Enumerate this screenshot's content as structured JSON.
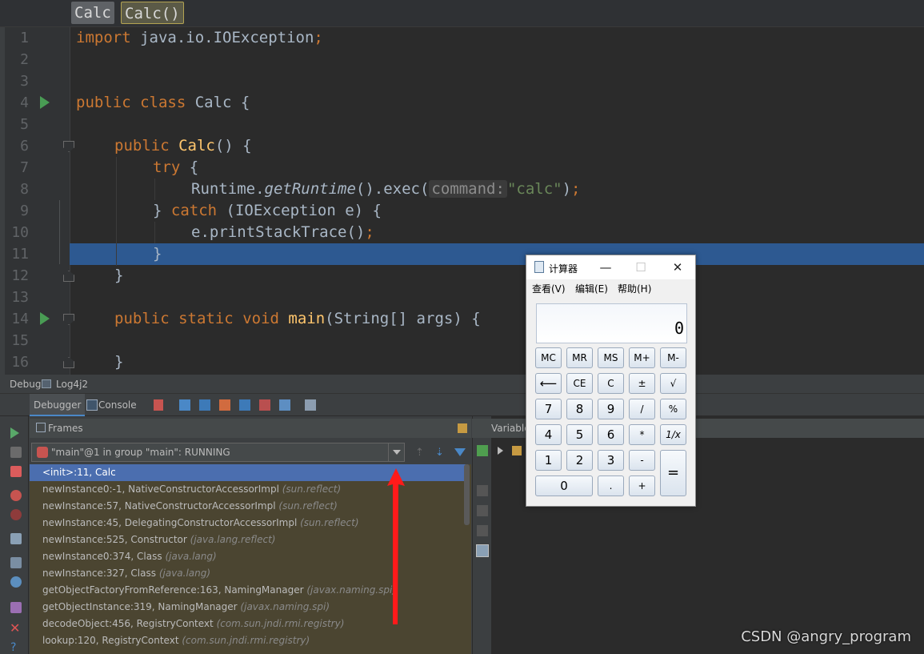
{
  "editor": {
    "breadcrumbs": [
      "Calc",
      "Calc()"
    ],
    "line_numbers": [
      "1",
      "2",
      "3",
      "4",
      "5",
      "6",
      "7",
      "8",
      "9",
      "10",
      "11",
      "12",
      "13",
      "14",
      "15",
      "16"
    ],
    "code": {
      "l1_import": "import",
      "l1_rest": " java.io.IOException",
      "l1_semi": ";",
      "l4_public": "public",
      "l4_class": "class",
      "l4_rest": " Calc {",
      "l6_public": "public",
      "l6_name": "Calc",
      "l6_rest": "() {",
      "l7_try": "try",
      "l7_rest": " {",
      "l8_a": "Runtime.",
      "l8_b": "getRuntime",
      "l8_c": "().exec(",
      "l8_hint": "command:",
      "l8_str": "\"calc\"",
      "l8_d": ")",
      "l8_semi": ";",
      "l9_a": "} ",
      "l9_catch": "catch",
      "l9_b": " (IOException e) {",
      "l10_a": "e.printStackTrace()",
      "l10_semi": ";",
      "l11": "}",
      "l12": "}",
      "l14_public": "public",
      "l14_static": "static",
      "l14_void": "void",
      "l14_main": "main",
      "l14_rest": "(String[] args) {",
      "l16": "}"
    }
  },
  "debug": {
    "tabs": [
      "Debug",
      "Log4j2"
    ],
    "toolbar": {
      "debugger": "Debugger",
      "console": "Console"
    },
    "frames_title": "Frames",
    "variables_title": "Variables",
    "thread": "\"main\"@1 in group \"main\": RUNNING",
    "frames": [
      {
        "method": "<init>:11, Calc",
        "pkg": ""
      },
      {
        "method": "newInstance0:-1, NativeConstructorAccessorImpl",
        "pkg": "(sun.reflect)"
      },
      {
        "method": "newInstance:57, NativeConstructorAccessorImpl",
        "pkg": "(sun.reflect)"
      },
      {
        "method": "newInstance:45, DelegatingConstructorAccessorImpl",
        "pkg": "(sun.reflect)"
      },
      {
        "method": "newInstance:525, Constructor",
        "pkg": "(java.lang.reflect)"
      },
      {
        "method": "newInstance0:374, Class",
        "pkg": "(java.lang)"
      },
      {
        "method": "newInstance:327, Class",
        "pkg": "(java.lang)"
      },
      {
        "method": "getObjectFactoryFromReference:163, NamingManager",
        "pkg": "(javax.naming.spi)"
      },
      {
        "method": "getObjectInstance:319, NamingManager",
        "pkg": "(javax.naming.spi)"
      },
      {
        "method": "decodeObject:456, RegistryContext",
        "pkg": "(com.sun.jndi.rmi.registry)"
      },
      {
        "method": "lookup:120, RegistryContext",
        "pkg": "(com.sun.jndi.rmi.registry)"
      }
    ]
  },
  "calculator": {
    "title": "计算器",
    "menu": [
      "查看(V)",
      "编辑(E)",
      "帮助(H)"
    ],
    "display": "0",
    "keys": {
      "mc": "MC",
      "mr": "MR",
      "ms": "MS",
      "mplus": "M+",
      "mminus": "M-",
      "back": "⟵",
      "ce": "CE",
      "c": "C",
      "pm": "±",
      "sqrt": "√",
      "k7": "7",
      "k8": "8",
      "k9": "9",
      "div": "/",
      "pct": "%",
      "k4": "4",
      "k5": "5",
      "k6": "6",
      "mul": "*",
      "recip": "1/x",
      "k1": "1",
      "k2": "2",
      "k3": "3",
      "sub": "-",
      "eq": "=",
      "k0": "0",
      "dot": ".",
      "add": "+"
    }
  },
  "watermark": "CSDN @angry_program",
  "colors": {
    "accent": "#2d5991",
    "selection": "#4b6eaf",
    "arrow": "#ff1a1a"
  }
}
